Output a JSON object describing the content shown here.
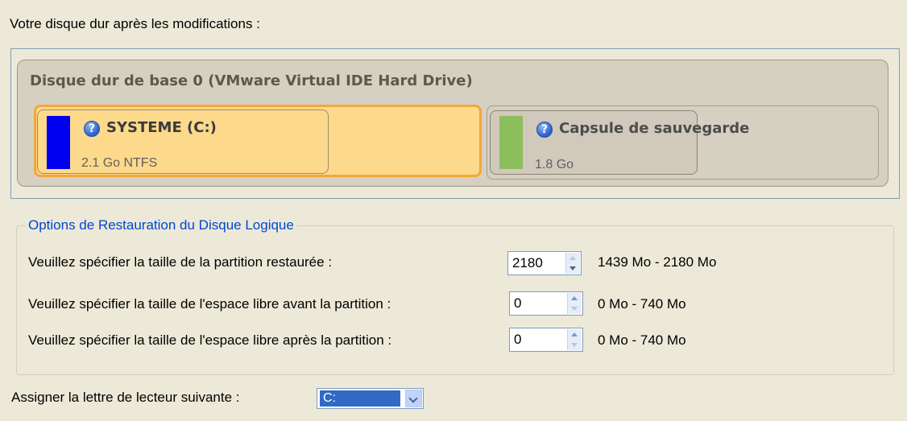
{
  "heading": "Votre disque dur après les modifications :",
  "disk": {
    "title": "Disque dur de base 0 (VMware Virtual IDE Hard Drive)",
    "partitions": [
      {
        "name": "SYSTEME (C:)",
        "info": "2.1 Go NTFS",
        "color": "#0000F0",
        "icon": "help-icon",
        "selected": true
      },
      {
        "name": "Capsule de sauvegarde",
        "info": "1.8 Go",
        "color": "#8CBF5C",
        "icon": "help-icon",
        "selected": false
      }
    ]
  },
  "options": {
    "legend": "Options de Restauration du Disque Logique",
    "rows": [
      {
        "label": "Veuillez spécifier la taille de la partition restaurée :",
        "value": "2180",
        "range": "1439 Mo - 2180 Mo"
      },
      {
        "label": "Veuillez spécifier la taille de l'espace libre avant la partition :",
        "value": "0",
        "range": "0 Mo - 740 Mo"
      },
      {
        "label": "Veuillez spécifier la taille de l'espace libre après la partition :",
        "value": "0",
        "range": "0 Mo - 740 Mo"
      }
    ]
  },
  "drive_letter": {
    "label": "Assigner la lettre de lecteur suivante :",
    "value": "C:"
  }
}
